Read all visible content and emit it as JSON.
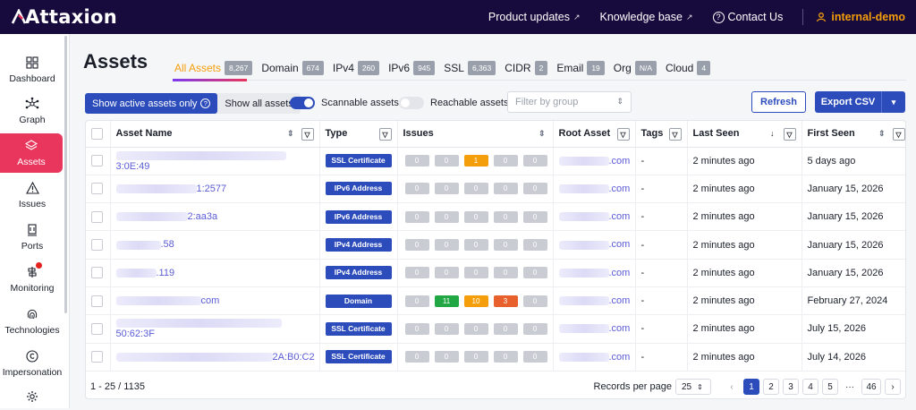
{
  "header": {
    "logo": "Attaxion",
    "links": [
      {
        "label": "Product updates"
      },
      {
        "label": "Knowledge base"
      },
      {
        "label": "Contact Us"
      }
    ],
    "user": "internal-demo"
  },
  "sidebar": {
    "items": [
      {
        "label": "Dashboard",
        "icon": "dashboard-icon"
      },
      {
        "label": "Graph",
        "icon": "graph-icon"
      },
      {
        "label": "Assets",
        "icon": "assets-icon",
        "active": true
      },
      {
        "label": "Issues",
        "icon": "warning-icon"
      },
      {
        "label": "Ports",
        "icon": "ports-icon"
      },
      {
        "label": "Monitoring",
        "icon": "monitoring-icon"
      },
      {
        "label": "Technologies",
        "icon": "fingerprint-icon"
      },
      {
        "label": "Impersonation",
        "icon": "impersonation-icon"
      }
    ]
  },
  "page": {
    "title": "Assets"
  },
  "tabs": [
    {
      "label": "All Assets",
      "count": "8,267",
      "active": true
    },
    {
      "label": "Domain",
      "count": "674"
    },
    {
      "label": "IPv4",
      "count": "260"
    },
    {
      "label": "IPv6",
      "count": "945"
    },
    {
      "label": "SSL",
      "count": "6,363"
    },
    {
      "label": "CIDR",
      "count": "2"
    },
    {
      "label": "Email",
      "count": "19"
    },
    {
      "label": "Org",
      "count": "N/A"
    },
    {
      "label": "Cloud",
      "count": "4"
    }
  ],
  "toolbar": {
    "show_active": "Show active assets only",
    "show_all": "Show all assets",
    "scannable": "Scannable assets",
    "reachable": "Reachable assets",
    "filter_placeholder": "Filter by group",
    "refresh": "Refresh",
    "export": "Export CSV"
  },
  "table": {
    "columns": [
      "Asset Name",
      "Type",
      "Issues",
      "Root Asset",
      "Tags",
      "Last Seen",
      "First Seen"
    ],
    "rows": [
      {
        "name": "3:0E:49",
        "type": "SSL Certificate",
        "issues": [
          "0",
          "0",
          "1",
          "0",
          "0"
        ],
        "root": ".com",
        "tags": "-",
        "last": "2 minutes ago",
        "first": "5 days ago"
      },
      {
        "name": "1:2577",
        "type": "IPv6 Address",
        "issues": [
          "0",
          "0",
          "0",
          "0",
          "0"
        ],
        "root": ".com",
        "tags": "-",
        "last": "2 minutes ago",
        "first": "January 15, 2026"
      },
      {
        "name": "2:aa3a",
        "type": "IPv6 Address",
        "issues": [
          "0",
          "0",
          "0",
          "0",
          "0"
        ],
        "root": ".com",
        "tags": "-",
        "last": "2 minutes ago",
        "first": "January 15, 2026"
      },
      {
        "name": ".58",
        "type": "IPv4 Address",
        "issues": [
          "0",
          "0",
          "0",
          "0",
          "0"
        ],
        "root": ".com",
        "tags": "-",
        "last": "2 minutes ago",
        "first": "January 15, 2026"
      },
      {
        "name": ".119",
        "type": "IPv4 Address",
        "issues": [
          "0",
          "0",
          "0",
          "0",
          "0"
        ],
        "root": ".com",
        "tags": "-",
        "last": "2 minutes ago",
        "first": "January 15, 2026"
      },
      {
        "name": "com",
        "type": "Domain",
        "issues": [
          "0",
          "11",
          "10",
          "3",
          "0"
        ],
        "root": ".com",
        "tags": "-",
        "last": "2 minutes ago",
        "first": "February 27, 2024"
      },
      {
        "name": "50:62:3F",
        "type": "SSL Certificate",
        "issues": [
          "0",
          "0",
          "0",
          "0",
          "0"
        ],
        "root": ".com",
        "tags": "-",
        "last": "2 minutes ago",
        "first": "July 15, 2026"
      },
      {
        "name": "2A:B0:C2",
        "type": "SSL Certificate",
        "issues": [
          "0",
          "0",
          "0",
          "0",
          "0"
        ],
        "root": ".com",
        "tags": "-",
        "last": "2 minutes ago",
        "first": "July 14, 2026"
      }
    ]
  },
  "footer": {
    "range": "1 - 25 / 1135",
    "rpp_label": "Records per page",
    "rpp_value": "25",
    "pages": [
      "1",
      "2",
      "3",
      "4",
      "5",
      "···",
      "46"
    ]
  },
  "colors": {
    "brand": "#170a3c",
    "accent": "#e8365d",
    "primary": "#2c4cbb",
    "warning": "#f59e0b"
  }
}
